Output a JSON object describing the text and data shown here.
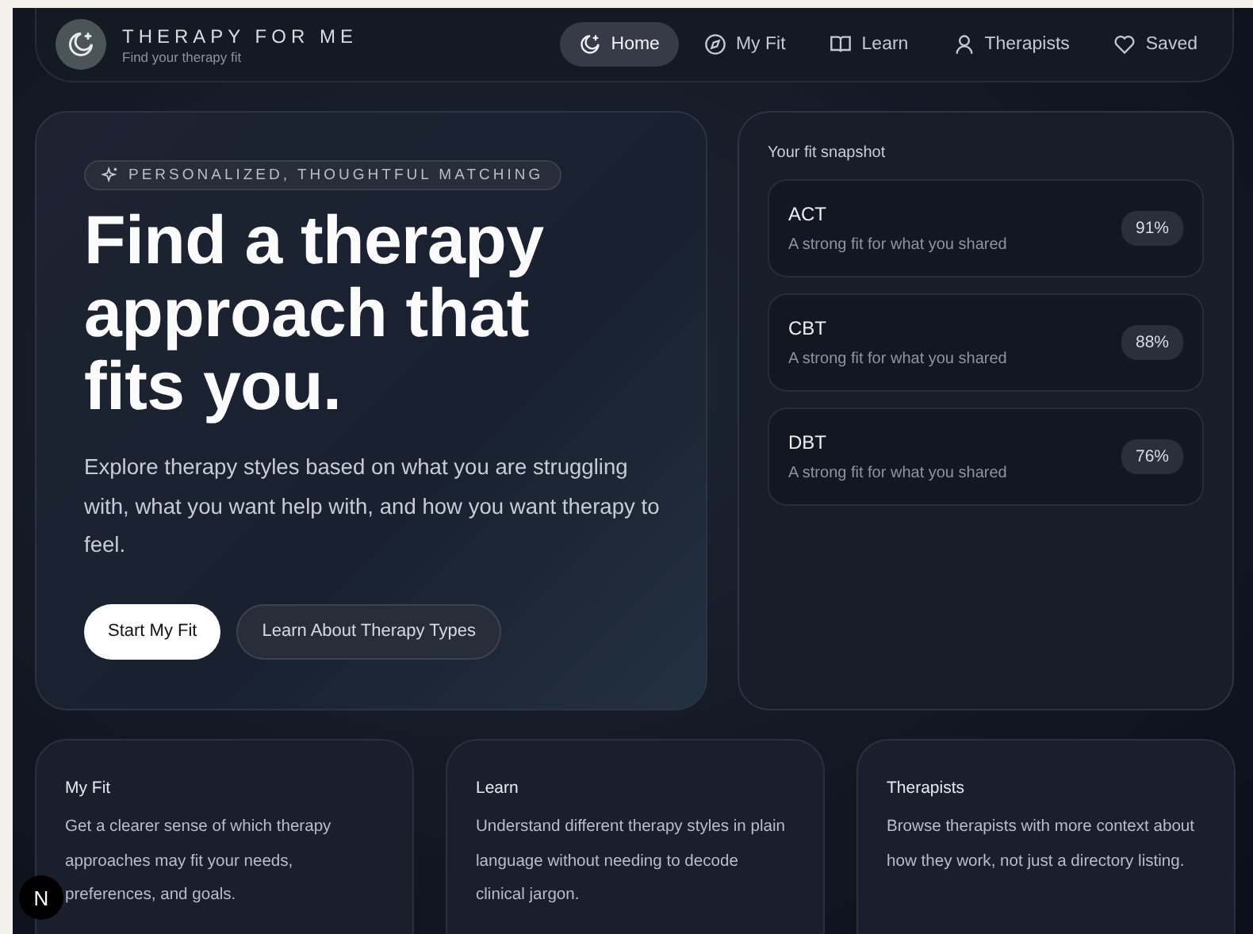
{
  "brand": {
    "title": "THERAPY FOR ME",
    "subtitle": "Find your therapy fit"
  },
  "nav": [
    {
      "label": "Home",
      "kind": "moon",
      "selected": true
    },
    {
      "label": "My Fit",
      "kind": "compass",
      "selected": false
    },
    {
      "label": "Learn",
      "kind": "book",
      "selected": false
    },
    {
      "label": "Therapists",
      "kind": "person",
      "selected": false
    },
    {
      "label": "Saved",
      "kind": "heart",
      "selected": false
    }
  ],
  "hero": {
    "badge": "PERSONALIZED, THOUGHTFUL MATCHING",
    "title": "Find a therapy approach that fits you.",
    "description": "Explore therapy styles based on what you are struggling with, what you want help with, and how you want therapy to feel.",
    "buttons": [
      {
        "label": "Start My Fit",
        "kind": "primary"
      },
      {
        "label": "Learn About Therapy Types",
        "kind": "secondary"
      }
    ]
  },
  "snapshot": {
    "title": "Your fit snapshot",
    "items": [
      {
        "name": "ACT",
        "note": "A strong fit for what you shared",
        "score": "91%"
      },
      {
        "name": "CBT",
        "note": "A strong fit for what you shared",
        "score": "88%"
      },
      {
        "name": "DBT",
        "note": "A strong fit for what you shared",
        "score": "76%"
      }
    ]
  },
  "features": [
    {
      "title": "My Fit",
      "text": "Get a clearer sense of which therapy approaches may fit your needs, preferences, and goals."
    },
    {
      "title": "Learn",
      "text": "Understand different therapy styles in plain language without needing to decode clinical jargon."
    },
    {
      "title": "Therapists",
      "text": "Browse therapists with more context about how they work, not just a directory listing."
    }
  ],
  "dev_badge": "N"
}
